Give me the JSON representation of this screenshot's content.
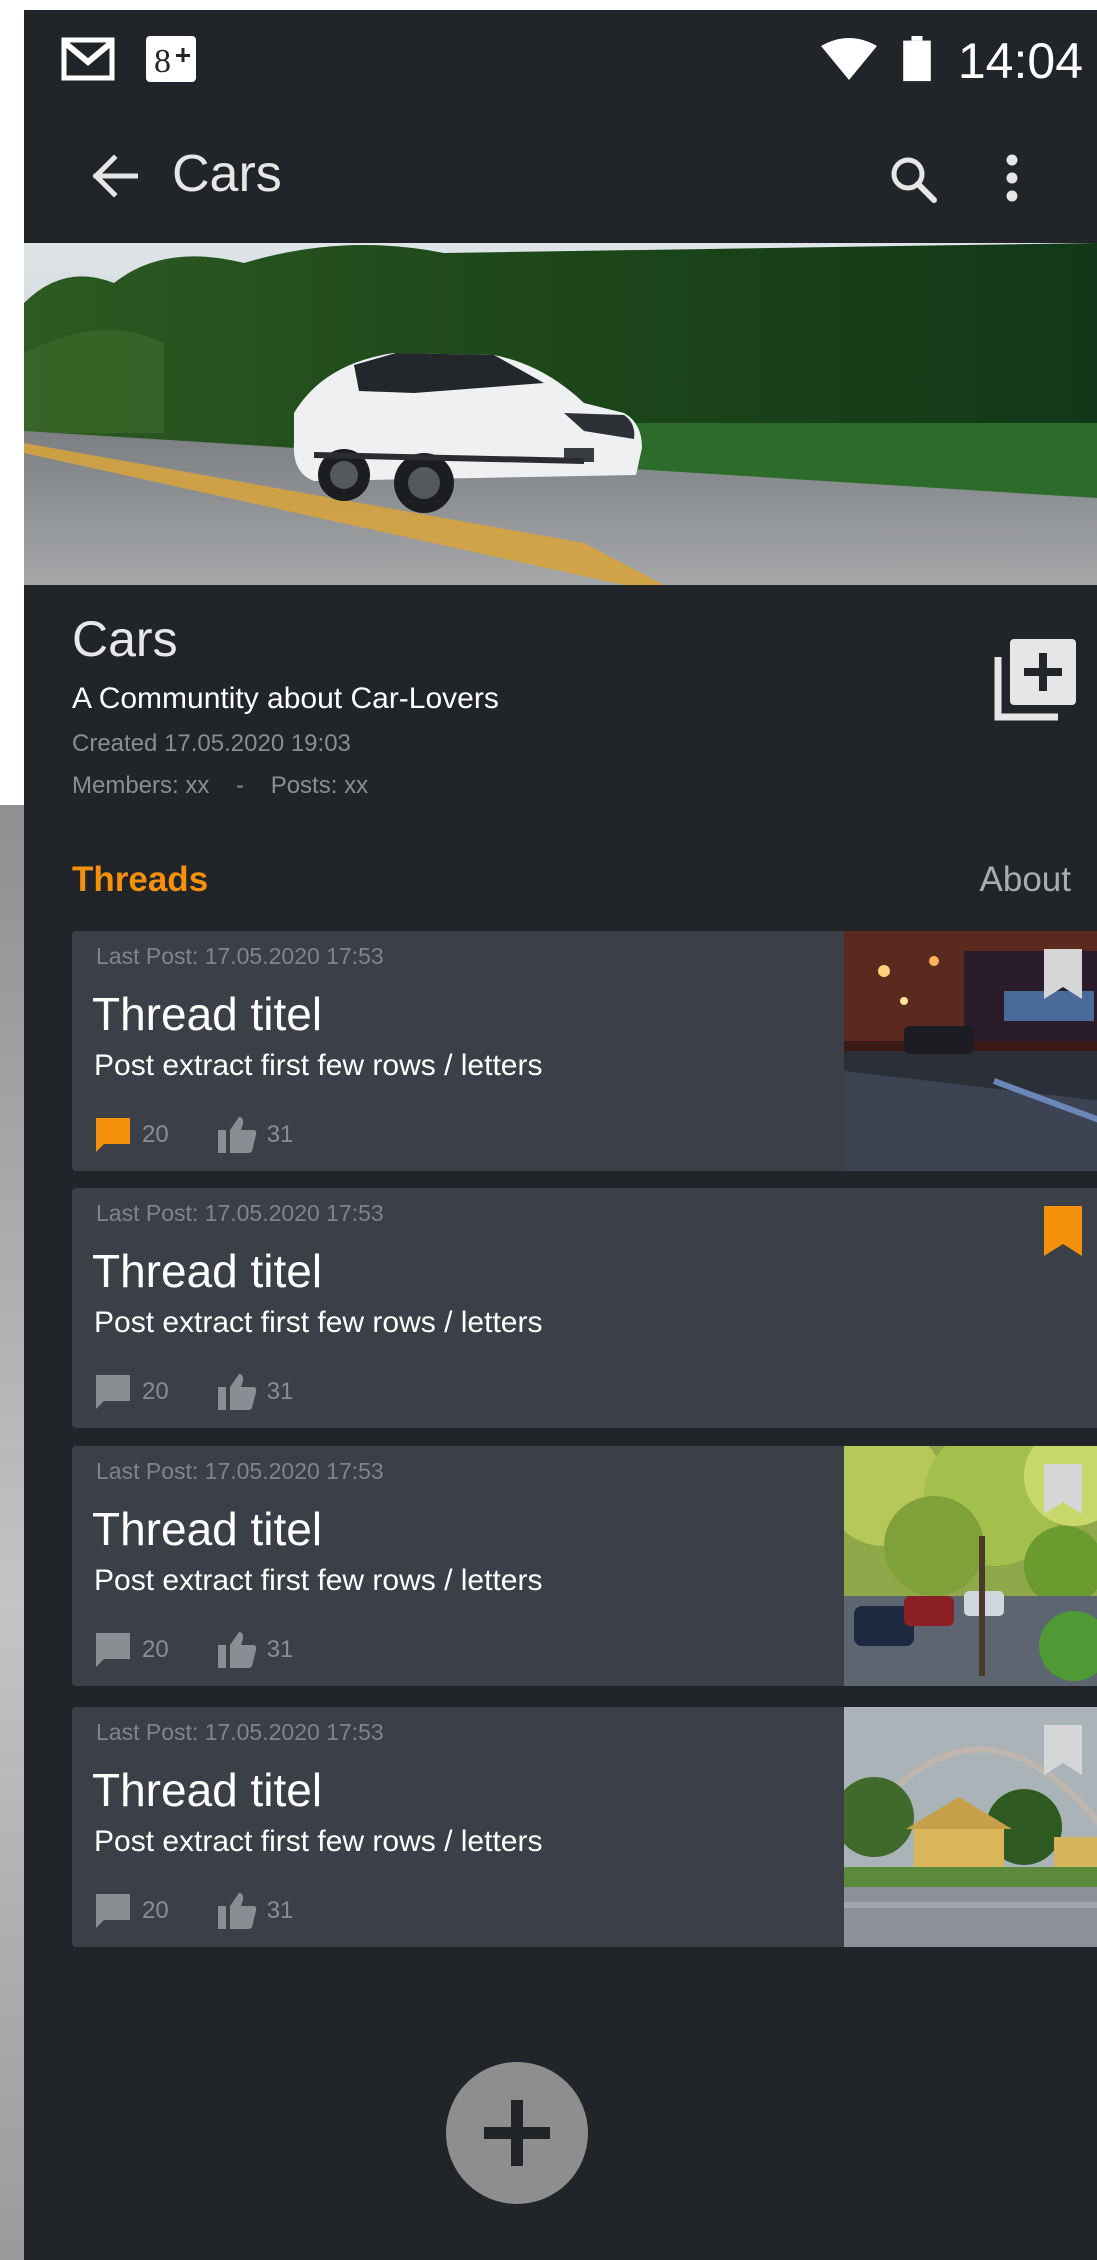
{
  "status_bar": {
    "time": "14:04",
    "icons": [
      "gmail-icon",
      "google-plus-icon",
      "wifi-icon",
      "battery-icon"
    ]
  },
  "toolbar": {
    "title": "Cars",
    "icons": [
      "back-arrow-icon",
      "search-icon",
      "more-vert-icon"
    ]
  },
  "community": {
    "title": "Cars",
    "description": "A Communtity about Car-Lovers",
    "created": "Created 17.05.2020 19:03",
    "members": "Members: xx",
    "separator": "-",
    "posts": "Posts: xx",
    "join_icon": "add-to-library-icon"
  },
  "tabs": {
    "threads": "Threads",
    "about": "About"
  },
  "colors": {
    "accent": "#f5900b",
    "background": "#212529",
    "card": "#3b4048",
    "muted": "#8a8d92"
  },
  "threads": [
    {
      "last_post": "Last Post: 17.05.2020 17:53",
      "title": "Thread titel",
      "excerpt": "Post extract first few rows / letters",
      "comments": "20",
      "likes": "31",
      "bookmarked": true,
      "comments_highlighted": true,
      "image": "city-night-street"
    },
    {
      "last_post": "Last Post: 17.05.2020 17:53",
      "title": "Thread titel",
      "excerpt": "Post extract first few rows / letters",
      "comments": "20",
      "likes": "31",
      "bookmarked": true,
      "comments_highlighted": false,
      "image": ""
    },
    {
      "last_post": "Last Post: 17.05.2020 17:53",
      "title": "Thread titel",
      "excerpt": "Post extract first few rows / letters",
      "comments": "20",
      "likes": "31",
      "bookmarked": false,
      "comments_highlighted": false,
      "image": "tree-lined-street"
    },
    {
      "last_post": "Last Post: 17.05.2020 17:53",
      "title": "Thread titel",
      "excerpt": "Post extract first few rows / letters",
      "comments": "20",
      "likes": "31",
      "bookmarked": false,
      "comments_highlighted": false,
      "image": "suburban-rainbow"
    }
  ],
  "fab": {
    "icon": "plus-icon"
  }
}
